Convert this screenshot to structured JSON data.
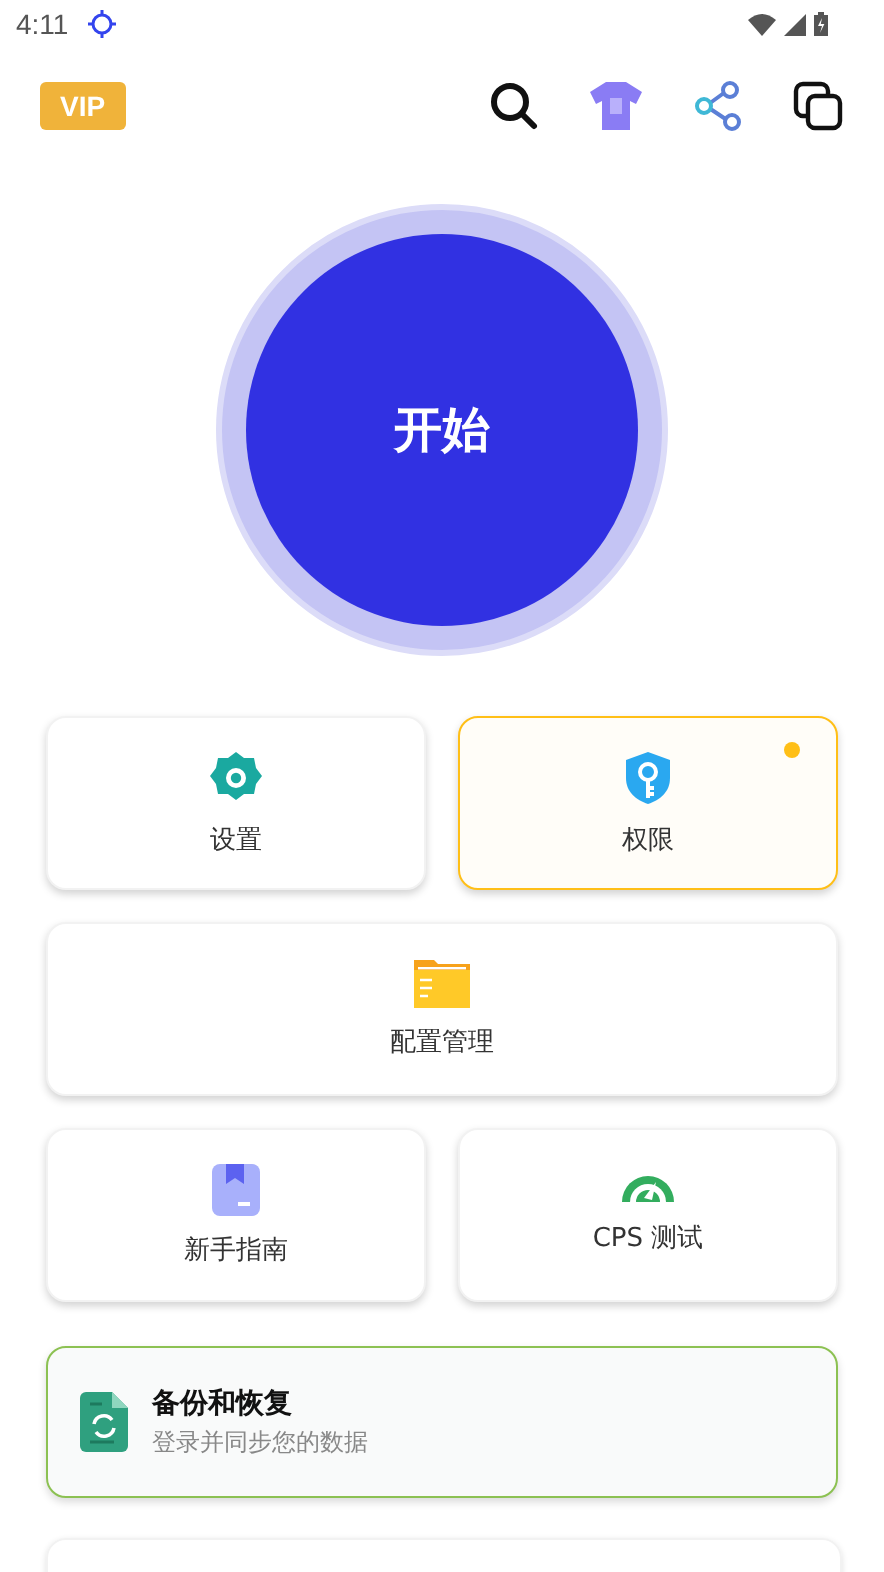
{
  "status_bar": {
    "time": "4:11"
  },
  "header": {
    "badge": "VIP"
  },
  "start_button": {
    "label": "开始"
  },
  "tiles": [
    {
      "kind": "half",
      "label": "设置",
      "highlighted": false
    },
    {
      "kind": "half",
      "label": "权限",
      "highlighted": true
    },
    {
      "kind": "full",
      "label": "配置管理",
      "highlighted": false
    },
    {
      "kind": "half",
      "label": "新手指南",
      "highlighted": false
    },
    {
      "kind": "half",
      "label": "CPS 测试",
      "highlighted": false
    }
  ],
  "backup_card": {
    "title": "备份和恢复",
    "subtitle": "登录并同步您的数据"
  }
}
